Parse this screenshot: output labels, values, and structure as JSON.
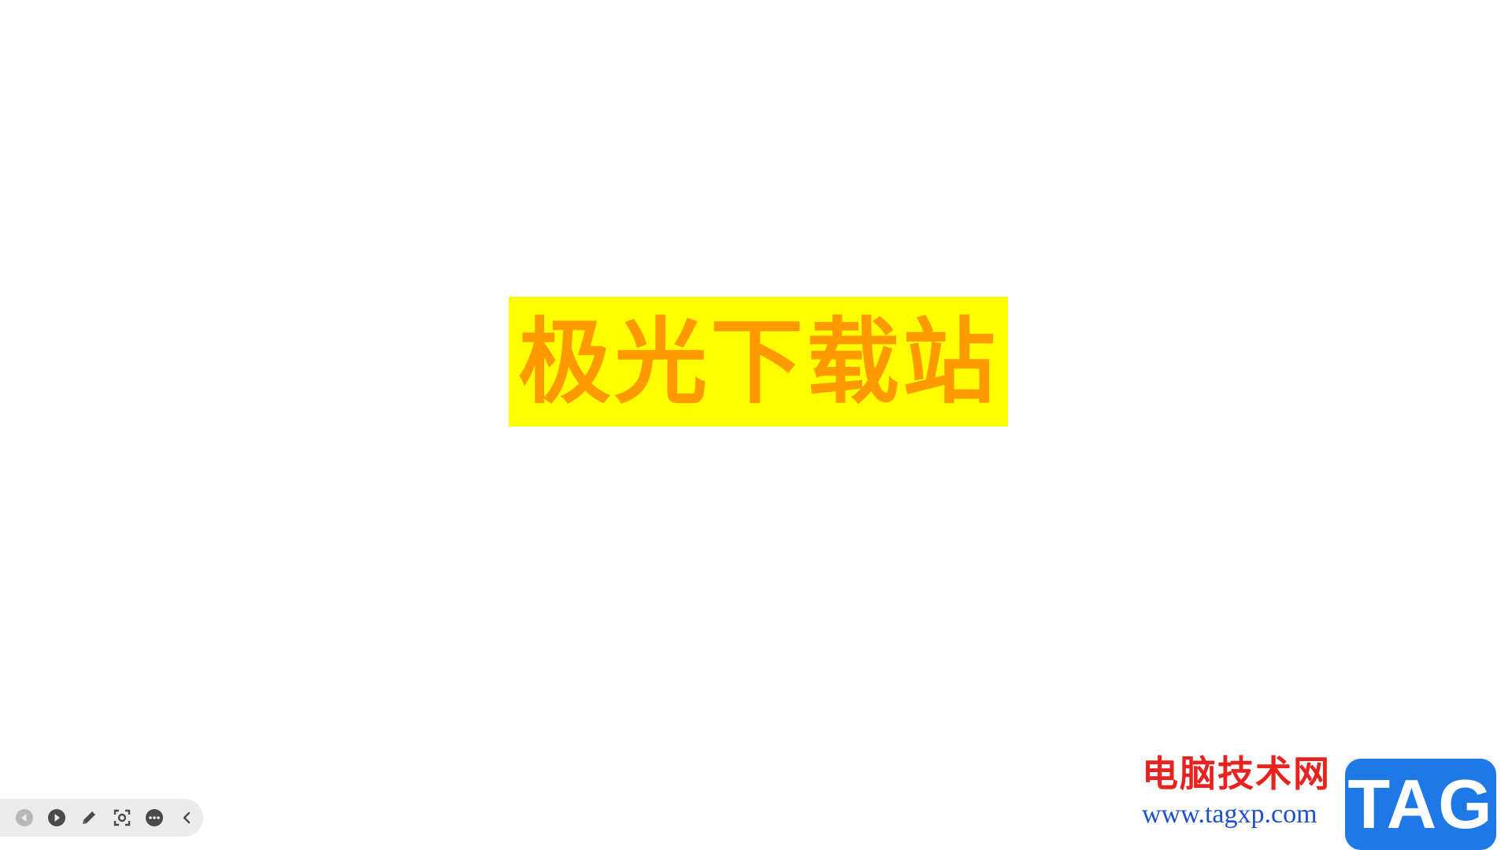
{
  "slide": {
    "title": "极光下载站",
    "title_color": "#ff9900",
    "title_bg_color": "#ffff00"
  },
  "toolbar": {
    "items": [
      {
        "icon": "previous-slide-icon"
      },
      {
        "icon": "next-slide-icon"
      },
      {
        "icon": "pen-icon"
      },
      {
        "icon": "zoom-icon"
      },
      {
        "icon": "more-options-icon"
      },
      {
        "icon": "collapse-chevron-icon"
      }
    ]
  },
  "watermark": {
    "site_name": "电脑技术网",
    "url": "www.tagxp.com",
    "logo_text": "TAG",
    "brand_red": "#e8231f",
    "brand_blue": "#1e78e6"
  }
}
